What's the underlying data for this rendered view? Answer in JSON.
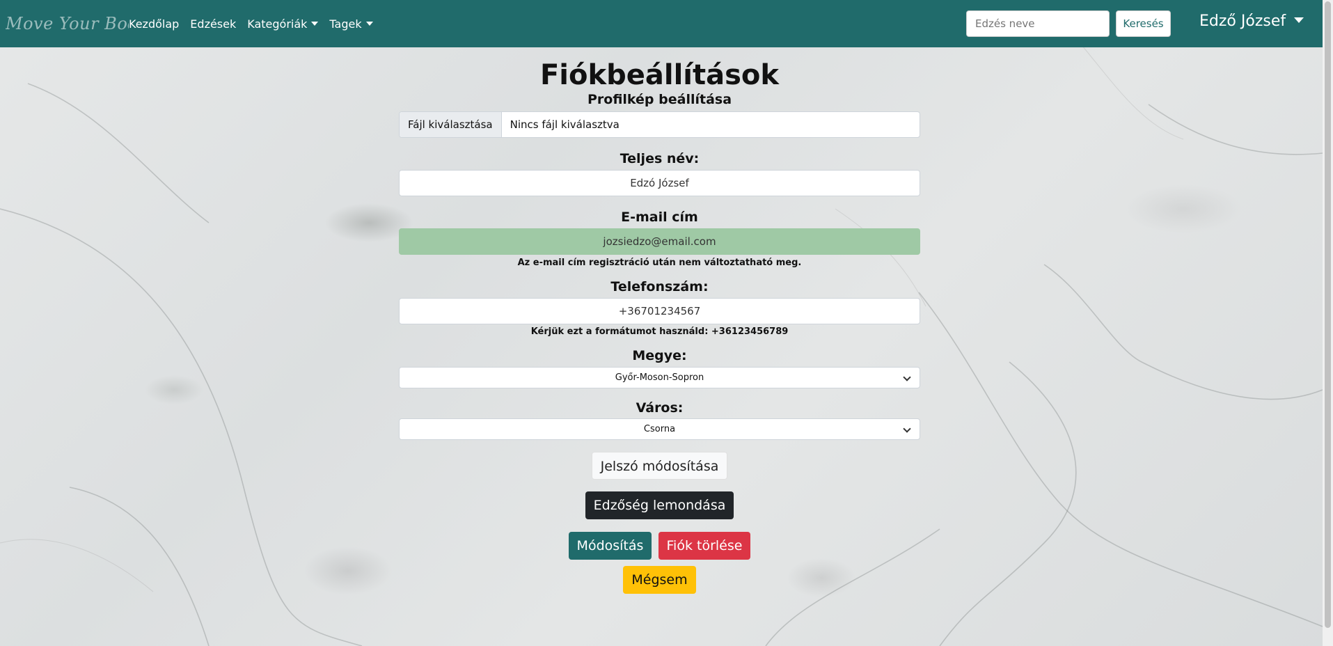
{
  "navbar": {
    "brand": "Move Your Body",
    "links": [
      "Kezdőlap",
      "Edzések",
      "Kategóriák",
      "Tagek"
    ],
    "search_placeholder": "Edzés neve",
    "search_button": "Keresés",
    "user_name": "Edző József"
  },
  "form": {
    "title": "Fiókbeállítások",
    "profile_label": "Profilkép beállítása",
    "file_button": "Fájl kiválasztása",
    "file_status": "Nincs fájl kiválasztva",
    "name_label": "Teljes név:",
    "name_value": "Edzó József",
    "email_label": "E-mail cím",
    "email_value": "jozsiedzo@email.com",
    "email_hint": "Az e-mail cím regisztráció után nem változtatható meg.",
    "phone_label": "Telefonszám:",
    "phone_value": "+36701234567",
    "phone_hint": "Kérjük ezt a formátumot használd: +36123456789",
    "county_label": "Megye:",
    "county_value": "Győr-Moson-Sopron",
    "city_label": "Város:",
    "city_value": "Csorna",
    "password_button": "Jelszó módosítása",
    "cancel_trainer_button": "Edzőség lemondása",
    "modify_button": "Módosítás",
    "delete_button": "Fiók törlése",
    "cancel_button": "Mégsem"
  },
  "colors": {
    "navbar": "#206b6b",
    "disabled_field": "#9fc9a5",
    "danger": "#dc3545",
    "warning": "#ffc107",
    "dark": "#212529"
  }
}
